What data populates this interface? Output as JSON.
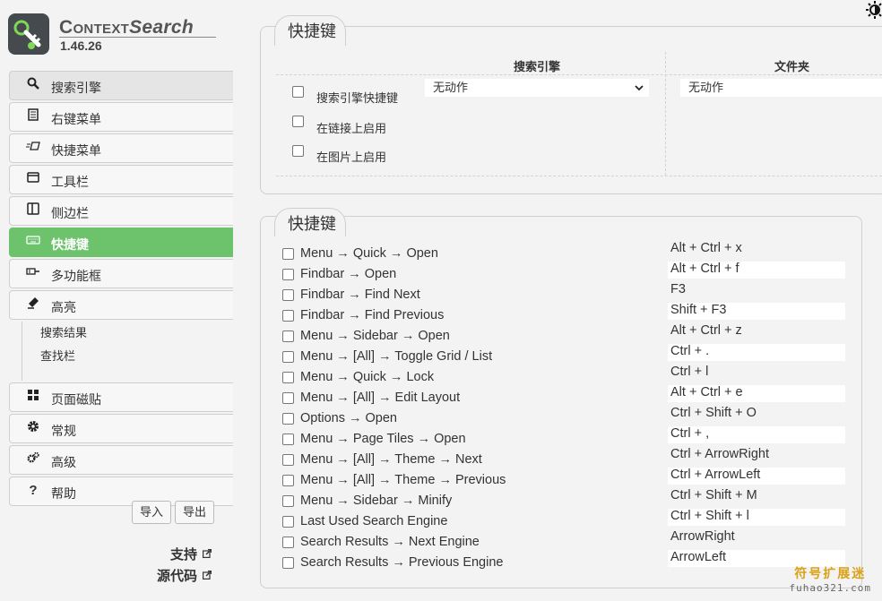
{
  "app": {
    "name_prefix": "Context",
    "name_suffix": "Search",
    "version": "1.46.26"
  },
  "colors": {
    "accent": "#6cc36c",
    "background": "#f3f3f3",
    "border": "#cfcfcf",
    "watermark": "#d9a21a"
  },
  "sidebar": {
    "items": [
      {
        "label": "搜索引擎",
        "icon": "search-icon",
        "state": "hover"
      },
      {
        "label": "右键菜单",
        "icon": "document-list-icon",
        "state": ""
      },
      {
        "label": "快捷菜单",
        "icon": "quick-menu-icon",
        "state": ""
      },
      {
        "label": "工具栏",
        "icon": "toolbar-window-icon",
        "state": ""
      },
      {
        "label": "侧边栏",
        "icon": "sidebar-panel-icon",
        "state": ""
      },
      {
        "label": "快捷键",
        "icon": "keyboard-icon",
        "state": "active"
      },
      {
        "label": "多功能框",
        "icon": "omnibox-icon",
        "state": ""
      },
      {
        "label": "高亮",
        "icon": "highlighter-icon",
        "state": ""
      }
    ],
    "subitems": [
      "搜索结果",
      "查找栏"
    ],
    "items_after": [
      {
        "label": "页面磁贴",
        "icon": "grid-tiles-icon"
      },
      {
        "label": "常规",
        "icon": "gear-icon"
      },
      {
        "label": "高级",
        "icon": "gears-icon"
      },
      {
        "label": "帮助",
        "icon": "question-icon"
      }
    ],
    "import_label": "导入",
    "export_label": "导出",
    "support_label": "支持",
    "source_label": "源代码"
  },
  "hotkeys_panel": {
    "title": "快捷键",
    "col_engines": "搜索引擎",
    "col_folders": "文件夹",
    "options": [
      {
        "label": "搜索引擎快捷键",
        "checked": false
      },
      {
        "label": "在链接上启用",
        "checked": false
      },
      {
        "label": "在图片上启用",
        "checked": false
      }
    ],
    "engine_action": "无动作",
    "folder_action": "无动作"
  },
  "shortcuts_panel": {
    "title": "快捷键",
    "rows": [
      {
        "name": "Menu → Quick → Open",
        "key": "Alt + Ctrl + x"
      },
      {
        "name": "Findbar → Open",
        "key": "Alt + Ctrl + f"
      },
      {
        "name": "Findbar → Find Next",
        "key": "F3"
      },
      {
        "name": "Findbar → Find Previous",
        "key": "Shift + F3"
      },
      {
        "name": "Menu → Sidebar → Open",
        "key": "Alt + Ctrl + z"
      },
      {
        "name": "Menu → [All] → Toggle Grid / List",
        "key": "Ctrl + ."
      },
      {
        "name": "Menu → Quick → Lock",
        "key": "Ctrl + l"
      },
      {
        "name": "Menu → [All] → Edit Layout",
        "key": "Alt + Ctrl + e"
      },
      {
        "name": "Options → Open",
        "key": "Ctrl + Shift + O"
      },
      {
        "name": "Menu → Page Tiles → Open",
        "key": "Ctrl + ,"
      },
      {
        "name": "Menu → [All] → Theme → Next",
        "key": "Ctrl + ArrowRight"
      },
      {
        "name": "Menu → [All] → Theme → Previous",
        "key": "Ctrl + ArrowLeft"
      },
      {
        "name": "Menu → Sidebar → Minify",
        "key": "Ctrl + Shift + M"
      },
      {
        "name": "Last Used Search Engine",
        "key": "Ctrl + Shift + l"
      },
      {
        "name": "Search Results → Next Engine",
        "key": "ArrowRight"
      },
      {
        "name": "Search Results → Previous Engine",
        "key": "ArrowLeft"
      }
    ]
  },
  "watermark": {
    "cn": "符号扩展迷",
    "en": "fuhao321.com"
  }
}
